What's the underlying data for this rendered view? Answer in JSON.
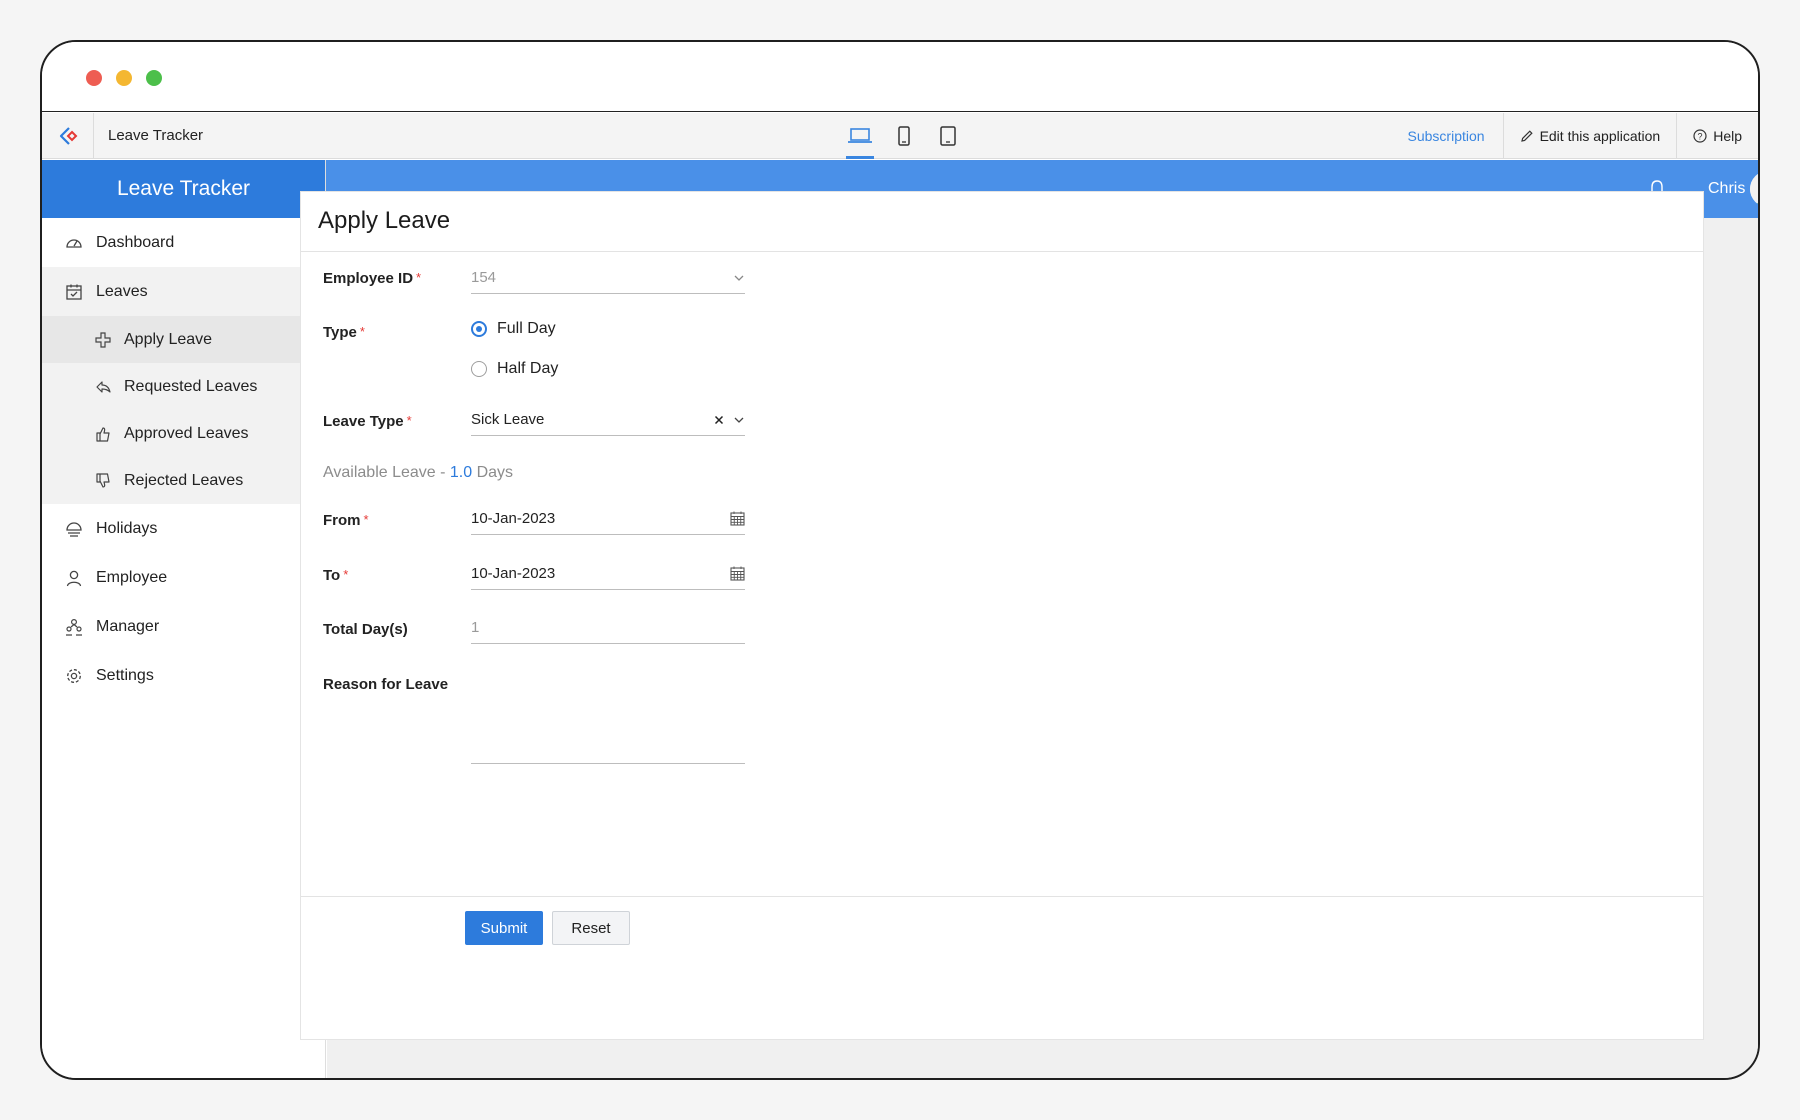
{
  "window": {
    "colors": {
      "close": "#ee5d52",
      "minimize": "#f4b731",
      "maximize": "#4cbf4a"
    }
  },
  "appbar": {
    "app_name": "Leave Tracker",
    "devices": [
      "laptop-icon",
      "phone-icon",
      "tablet-icon"
    ],
    "subscription_label": "Subscription",
    "edit_label": "Edit this application",
    "help_label": "Help"
  },
  "sidebar": {
    "title": "Leave Tracker",
    "items": [
      {
        "label": "Dashboard",
        "icon": "dashboard-icon"
      },
      {
        "label": "Leaves",
        "icon": "calendar-icon",
        "expanded": true
      },
      {
        "label": "Holidays",
        "icon": "holiday-icon"
      },
      {
        "label": "Employee",
        "icon": "user-icon"
      },
      {
        "label": "Manager",
        "icon": "manager-icon"
      },
      {
        "label": "Settings",
        "icon": "gear-icon"
      }
    ],
    "leaves_sub": [
      {
        "label": "Apply Leave",
        "icon": "plus-icon",
        "active": true
      },
      {
        "label": "Requested Leaves",
        "icon": "reply-icon"
      },
      {
        "label": "Approved Leaves",
        "icon": "thumbs-up-icon"
      },
      {
        "label": "Rejected Leaves",
        "icon": "thumbs-down-icon"
      }
    ]
  },
  "topbar": {
    "user_name": "Chris",
    "accent": "#4a90e8"
  },
  "form": {
    "title": "Apply Leave",
    "employee_id_label": "Employee ID",
    "employee_id_value": "154",
    "type_label": "Type",
    "type_options": [
      "Full Day",
      "Half Day"
    ],
    "type_selected": "Full Day",
    "leave_type_label": "Leave Type",
    "leave_type_value": "Sick Leave",
    "available_prefix": "Available Leave - ",
    "available_value": "1.0",
    "available_suffix": " Days",
    "from_label": "From",
    "from_value": "10-Jan-2023",
    "to_label": "To",
    "to_value": "10-Jan-2023",
    "total_label": "Total Day(s)",
    "total_value": "1",
    "reason_label": "Reason for Leave",
    "submit_label": "Submit",
    "reset_label": "Reset",
    "required_mark": "*"
  }
}
